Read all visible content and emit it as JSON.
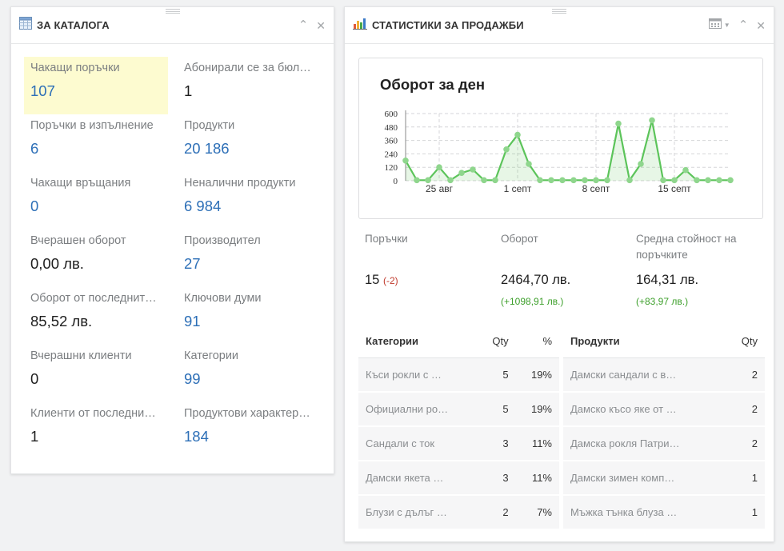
{
  "catalog": {
    "title": "ЗА КАТАЛОГА",
    "icon": "table-icon",
    "items": [
      {
        "label": "Чакащи поръчки",
        "value": "107",
        "link": true
      },
      {
        "label": "Абонирали се за бюл…",
        "value": "1",
        "link": false
      },
      {
        "label": "Поръчки в изпълнение",
        "value": "6",
        "link": true
      },
      {
        "label": "Продукти",
        "value": "20 186",
        "link": true
      },
      {
        "label": "Чакащи връщания",
        "value": "0",
        "link": true
      },
      {
        "label": "Неналични продукти",
        "value": "6 984",
        "link": true
      },
      {
        "label": "Вчерашен оборот",
        "value": "0,00 лв.",
        "link": false
      },
      {
        "label": "Производител",
        "value": "27",
        "link": true
      },
      {
        "label": "Оборот от последнит…",
        "value": "85,52 лв.",
        "link": false
      },
      {
        "label": "Ключови думи",
        "value": "91",
        "link": true
      },
      {
        "label": "Вчерашни клиенти",
        "value": "0",
        "link": false
      },
      {
        "label": "Категории",
        "value": "99",
        "link": true
      },
      {
        "label": "Клиенти от последни…",
        "value": "1",
        "link": false
      },
      {
        "label": "Продуктови характер…",
        "value": "184",
        "link": true
      }
    ]
  },
  "sales": {
    "title": "СТАТИСТИКИ ЗА ПРОДАЖБИ",
    "icon": "bar-chart-icon",
    "chart_title": "Оборот за ден",
    "stats": {
      "orders_label": "Поръчки",
      "orders_value": "15",
      "orders_diff": "(-2)",
      "revenue_label": "Оборот",
      "revenue_value": "2464,70 лв.",
      "revenue_diff": "(+1098,91 лв.)",
      "avg_label": "Средна стойност на поръчките",
      "avg_value": "164,31 лв.",
      "avg_diff": "(+83,97 лв.)"
    },
    "categories_table": {
      "headers": [
        "Категории",
        "Qty",
        "%"
      ],
      "rows": [
        [
          "Къси рокли с …",
          "5",
          "19%"
        ],
        [
          "Официални ро…",
          "5",
          "19%"
        ],
        [
          "Сандали с ток",
          "3",
          "11%"
        ],
        [
          "Дамски якета …",
          "3",
          "11%"
        ],
        [
          "Блузи с дълъг …",
          "2",
          "7%"
        ]
      ]
    },
    "products_table": {
      "headers": [
        "Продукти",
        "Qty"
      ],
      "rows": [
        [
          "Дамски сандали с в…",
          "2"
        ],
        [
          "Дамско късо яке от …",
          "2"
        ],
        [
          "Дамска рокля Патри…",
          "2"
        ],
        [
          "Дамски зимен комп…",
          "1"
        ],
        [
          "Мъжка тънка блуза …",
          "1"
        ]
      ]
    }
  },
  "chart_data": {
    "type": "area",
    "title": "Оборот за ден",
    "ylim": [
      0,
      600
    ],
    "yticks": [
      "600",
      "480",
      "360",
      "240",
      "120",
      "0"
    ],
    "xticks": [
      "25 авг",
      "1 септ",
      "8 септ",
      "15 септ"
    ],
    "xtick_index": [
      3,
      10,
      17,
      24
    ],
    "grid": true,
    "color": "#5cc45a",
    "values": [
      180,
      5,
      5,
      120,
      5,
      70,
      100,
      5,
      5,
      280,
      410,
      150,
      5,
      5,
      5,
      5,
      5,
      5,
      5,
      510,
      5,
      150,
      540,
      5,
      5,
      95,
      5,
      5,
      5,
      5
    ]
  }
}
